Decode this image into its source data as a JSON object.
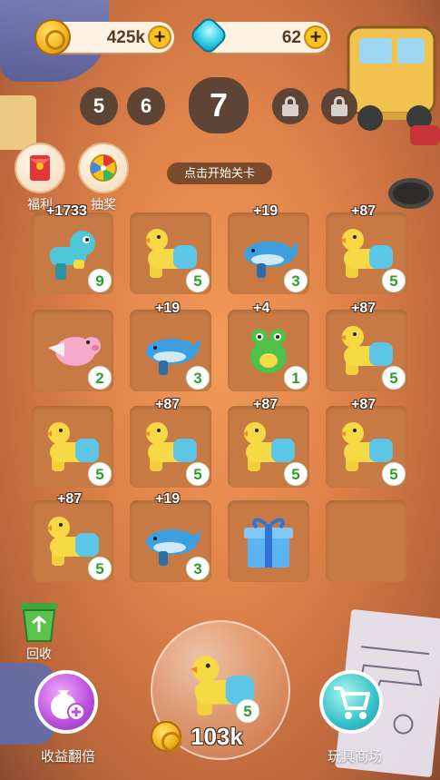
{
  "resources": {
    "coins": "425k",
    "gems": "62"
  },
  "levels": {
    "prev1": "5",
    "prev2": "6",
    "current": "7"
  },
  "side_buttons": {
    "welfare": "福利",
    "lottery": "抽奖"
  },
  "start_hint": "点击开始关卡",
  "slots": [
    {
      "toy": "dino-blaster",
      "count": "9",
      "bonus": "+1733"
    },
    {
      "toy": "duck-blaster",
      "count": "5",
      "bonus": ""
    },
    {
      "toy": "dolphin-blaster",
      "count": "3",
      "bonus": "+19"
    },
    {
      "toy": "duck-blaster",
      "count": "5",
      "bonus": "+87"
    },
    {
      "toy": "pig-plane",
      "count": "2",
      "bonus": ""
    },
    {
      "toy": "dolphin-blaster",
      "count": "3",
      "bonus": "+19"
    },
    {
      "toy": "frog",
      "count": "1",
      "bonus": "+4"
    },
    {
      "toy": "duck-blaster",
      "count": "5",
      "bonus": "+87"
    },
    {
      "toy": "duck-blaster",
      "count": "5",
      "bonus": ""
    },
    {
      "toy": "duck-blaster",
      "count": "5",
      "bonus": "+87"
    },
    {
      "toy": "duck-blaster",
      "count": "5",
      "bonus": "+87"
    },
    {
      "toy": "duck-blaster",
      "count": "5",
      "bonus": "+87"
    },
    {
      "toy": "duck-blaster",
      "count": "5",
      "bonus": "+87"
    },
    {
      "toy": "dolphin-blaster",
      "count": "3",
      "bonus": "+19"
    },
    {
      "toy": "gift-box",
      "count": "",
      "bonus": ""
    },
    {
      "toy": "empty",
      "count": "",
      "bonus": ""
    }
  ],
  "recycle_label": "回收",
  "buy": {
    "toy": "duck-blaster",
    "count": "5",
    "price": "103k"
  },
  "bottom": {
    "double_income": "收益翻倍",
    "toy_shop": "玩具商场"
  },
  "colors": {
    "count_green": "#2e9f2e",
    "gem": "#2fd2e8",
    "coin": "#f1b11c"
  }
}
